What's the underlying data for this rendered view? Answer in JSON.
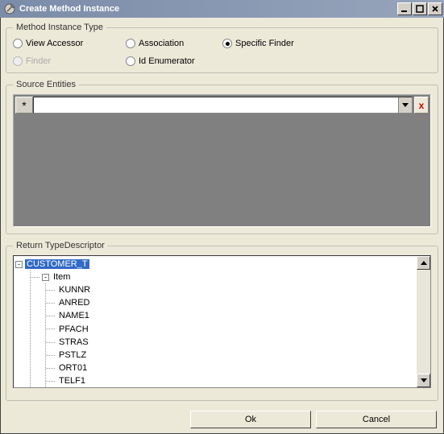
{
  "titlebar": {
    "title": "Create Method Instance"
  },
  "groups": {
    "method_instance_type": {
      "legend": "Method Instance Type",
      "radios": {
        "view_accessor": "View Accessor",
        "association": "Association",
        "specific_finder": "Specific Finder",
        "finder": "Finder",
        "id_enumerator": "Id Enumerator"
      }
    },
    "source_entities": {
      "legend": "Source Entities",
      "star": "*"
    },
    "return_td": {
      "legend": "Return TypeDescriptor"
    }
  },
  "tree": {
    "root": "CUSTOMER_T",
    "item_label": "Item",
    "fields": [
      "KUNNR",
      "ANRED",
      "NAME1",
      "PFACH",
      "STRAS",
      "PSTLZ",
      "ORT01",
      "TELF1"
    ]
  },
  "buttons": {
    "ok": "Ok",
    "cancel": "Cancel"
  },
  "icons": {
    "delete_x": "x"
  }
}
